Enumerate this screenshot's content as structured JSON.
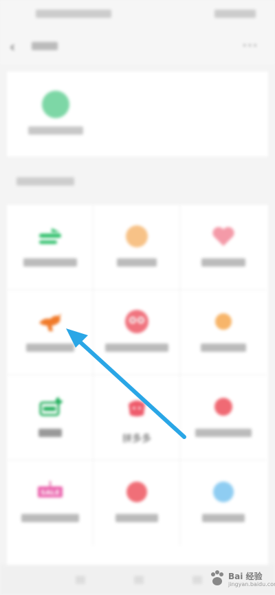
{
  "grid": {
    "items": [
      {
        "label": ""
      },
      {
        "label": ""
      },
      {
        "label": ""
      },
      {
        "label": ""
      },
      {
        "label": ""
      },
      {
        "label": ""
      },
      {
        "label": ""
      },
      {
        "label": "拼多多"
      },
      {
        "label": ""
      },
      {
        "label": ""
      },
      {
        "label": ""
      },
      {
        "label": ""
      }
    ],
    "sale_badge": "SALE"
  },
  "watermark": {
    "brand": "Bai 经验",
    "sub": "jingyan.baidu.com"
  }
}
